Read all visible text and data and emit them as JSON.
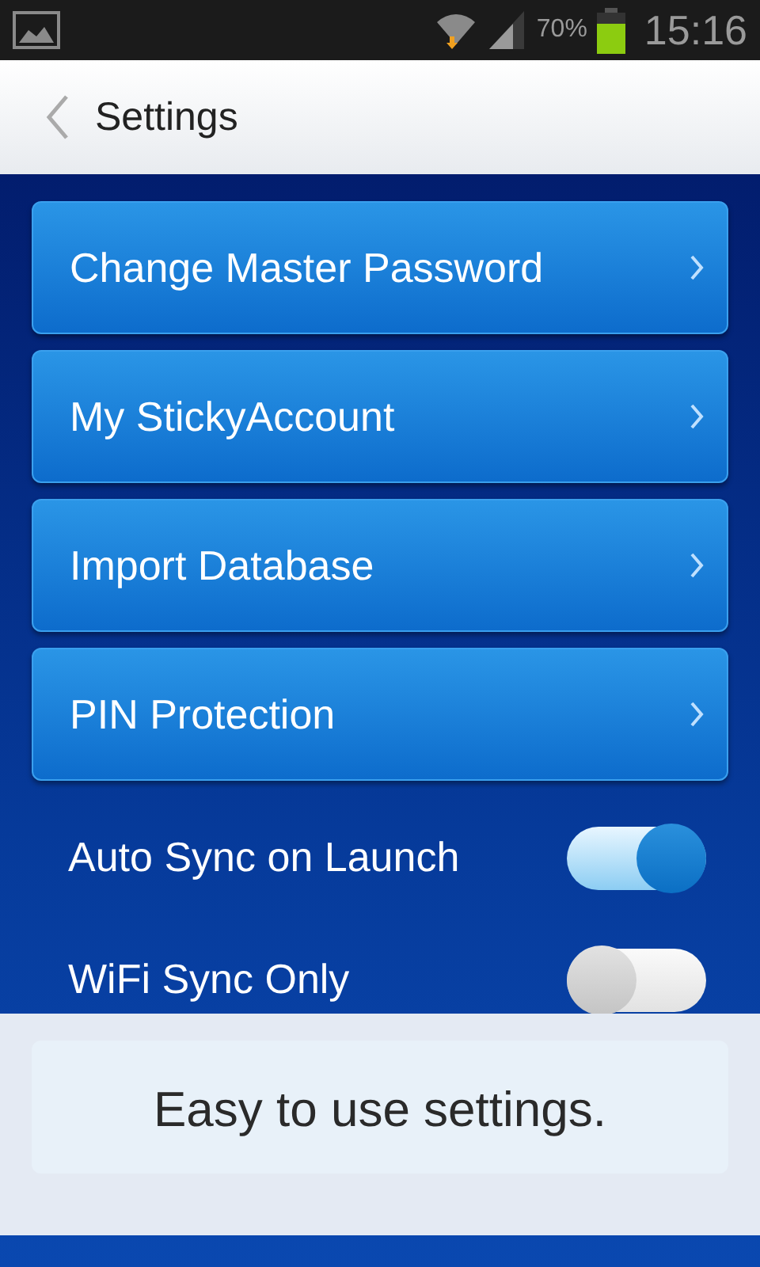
{
  "status_bar": {
    "battery_percent": "70%",
    "time": "15:16"
  },
  "header": {
    "title": "Settings"
  },
  "items": [
    {
      "kind": "link",
      "label": "Change Master Password"
    },
    {
      "kind": "link",
      "label": "My StickyAccount"
    },
    {
      "kind": "link",
      "label": "Import Database"
    },
    {
      "kind": "link",
      "label": "PIN Protection"
    },
    {
      "kind": "toggle",
      "label": "Auto Sync on Launch",
      "on": true
    },
    {
      "kind": "toggle",
      "label": "WiFi Sync Only",
      "on": false
    }
  ],
  "caption": "Easy to use settings."
}
